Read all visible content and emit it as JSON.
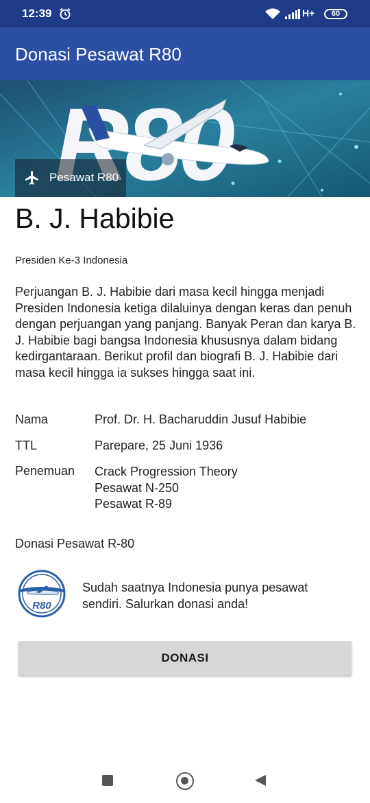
{
  "status_bar": {
    "time": "12:39",
    "network": "H+",
    "battery": "60",
    "icons": [
      "alarm-icon",
      "wifi-icon",
      "signal-icon",
      "battery-icon"
    ]
  },
  "app_bar": {
    "title": "Donasi Pesawat R80"
  },
  "banner": {
    "label": "Pesawat R80",
    "icon": "airplane-icon"
  },
  "profile": {
    "name": "B. J. Habibie",
    "subtitle": "Presiden Ke-3 Indonesia",
    "description": "Perjuangan B. J. Habibie dari masa kecil hingga menjadi Presiden Indonesia ketiga dilaluinya dengan keras dan penuh dengan perjuangan yang panjang. Banyak Peran dan karya B. J. Habibie bagi bangsa Indonesia khususnya dalam bidang kedirgantaraan. Berikut profil dan biografi B. J. Habibie dari masa kecil hingga ia sukses hingga saat ini."
  },
  "info": {
    "nama_label": "Nama",
    "nama_value": "Prof. Dr. H. Bacharuddin Jusuf Habibie",
    "ttl_label": "TTL",
    "ttl_value": "Parepare, 25 Juni 1936",
    "penemuan_label": "Penemuan",
    "penemuan_values": [
      "Crack Progression Theory",
      "Pesawat N-250",
      "Pesawat R-89"
    ]
  },
  "donation": {
    "section_title": "Donasi Pesawat R-80",
    "logo_text": "R80",
    "message": "Sudah saatnya Indonesia punya pesawat sendiri. Salurkan donasi anda!",
    "button_label": "DONASI"
  },
  "colors": {
    "status_bar": "#1d3b86",
    "app_bar": "#2a4fa3",
    "banner": "#1f6586",
    "button": "#d7d7d7"
  }
}
